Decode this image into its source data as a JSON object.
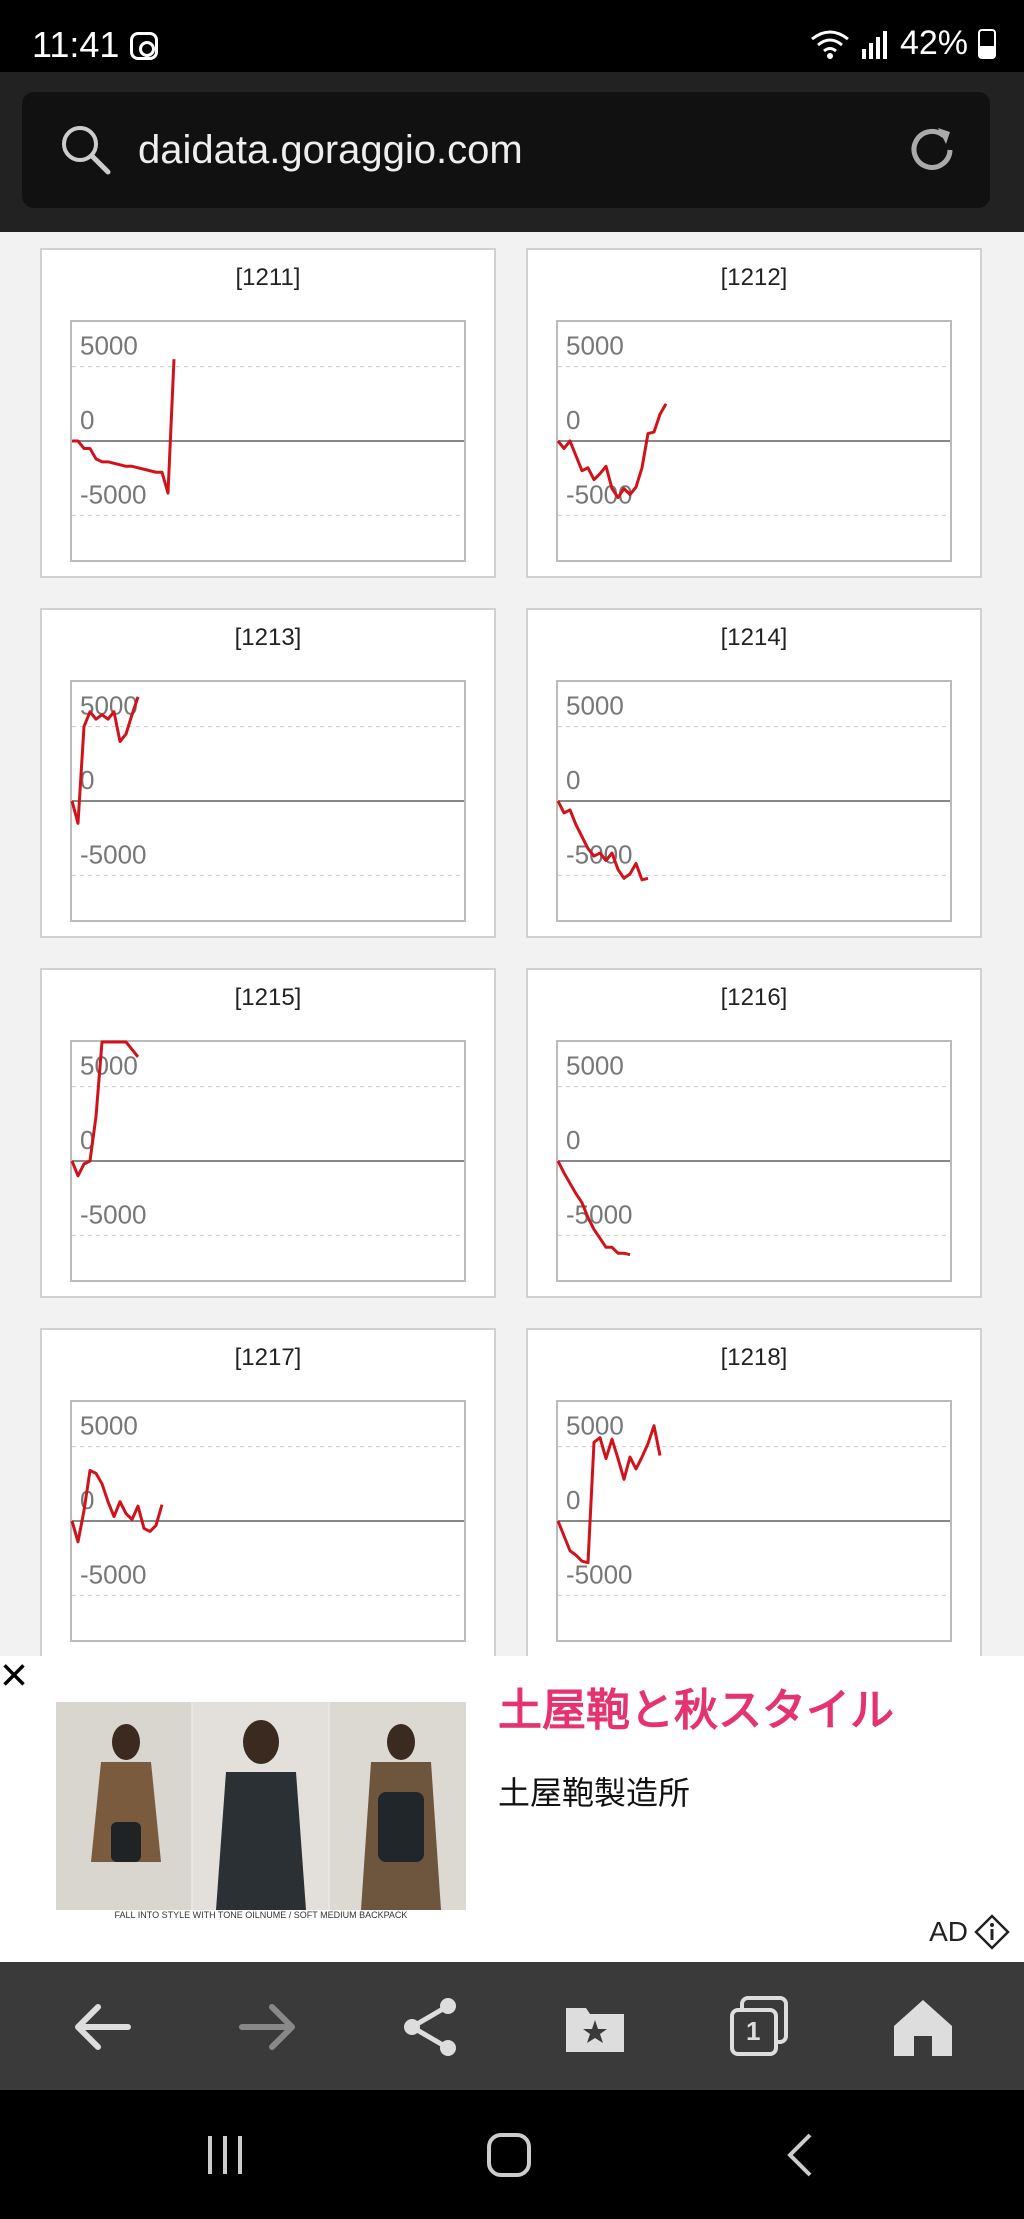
{
  "status": {
    "time": "11:41",
    "battery": "42%",
    "app_icon": "instagram-icon"
  },
  "browser": {
    "url": "daidata.goraggio.com"
  },
  "chart_data": [
    {
      "type": "line",
      "title": "[1211]",
      "ylim": [
        -8000,
        8000
      ],
      "yticks": [
        5000,
        0,
        -5000
      ],
      "series": [
        {
          "values": [
            0,
            0,
            -500,
            -500,
            -1200,
            -1400,
            -1400,
            -1500,
            -1600,
            -1700,
            -1700,
            -1800,
            -1900,
            -2000,
            -2100,
            -2100,
            -3500,
            5500
          ]
        }
      ]
    },
    {
      "type": "line",
      "title": "[1212]",
      "ylim": [
        -8000,
        8000
      ],
      "yticks": [
        5000,
        0,
        -5000
      ],
      "series": [
        {
          "values": [
            0,
            -500,
            0,
            -1000,
            -2000,
            -1800,
            -2600,
            -2200,
            -1700,
            -3200,
            -3800,
            -3200,
            -3600,
            -3100,
            -1800,
            500,
            600,
            1800,
            2500
          ]
        }
      ]
    },
    {
      "type": "line",
      "title": "[1213]",
      "ylim": [
        -8000,
        8000
      ],
      "yticks": [
        5000,
        0,
        -5000
      ],
      "series": [
        {
          "values": [
            0,
            -1500,
            5000,
            6000,
            5500,
            5800,
            5500,
            6000,
            4000,
            4500,
            5800,
            7000
          ]
        }
      ]
    },
    {
      "type": "line",
      "title": "[1214]",
      "ylim": [
        -8000,
        8000
      ],
      "yticks": [
        5000,
        0,
        -5000
      ],
      "series": [
        {
          "values": [
            0,
            -800,
            -600,
            -1600,
            -2400,
            -3200,
            -3700,
            -3500,
            -4000,
            -3500,
            -4600,
            -5200,
            -4900,
            -4200,
            -5300,
            -5200
          ]
        }
      ]
    },
    {
      "type": "line",
      "title": "[1215]",
      "ylim": [
        -8000,
        8000
      ],
      "yticks": [
        5000,
        0,
        -5000
      ],
      "series": [
        {
          "values": [
            0,
            -1000,
            -200,
            0,
            3000,
            8000,
            8000,
            8000,
            8000,
            8000,
            7500,
            7000
          ]
        }
      ]
    },
    {
      "type": "line",
      "title": "[1216]",
      "ylim": [
        -8000,
        8000
      ],
      "yticks": [
        5000,
        0,
        -5000
      ],
      "series": [
        {
          "values": [
            0,
            -800,
            -1500,
            -2200,
            -2800,
            -3800,
            -4600,
            -5200,
            -5800,
            -5800,
            -6200,
            -6200,
            -6300
          ]
        }
      ]
    },
    {
      "type": "line",
      "title": "[1217]",
      "ylim": [
        -8000,
        8000
      ],
      "yticks": [
        5000,
        0,
        -5000
      ],
      "series": [
        {
          "values": [
            0,
            -1400,
            700,
            3400,
            3200,
            2500,
            1300,
            300,
            1300,
            500,
            100,
            1000,
            -500,
            -700,
            -300,
            1100
          ]
        }
      ]
    },
    {
      "type": "line",
      "title": "[1218]",
      "ylim": [
        -8000,
        8000
      ],
      "yticks": [
        5000,
        0,
        -5000
      ],
      "series": [
        {
          "values": [
            0,
            -1000,
            -2000,
            -2300,
            -2700,
            -2800,
            5300,
            5600,
            4200,
            5500,
            4200,
            2800,
            4300,
            3500,
            4300,
            5200,
            6400,
            4400
          ]
        }
      ]
    }
  ],
  "ad": {
    "close": "×",
    "headline": "土屋鞄と秋スタイル",
    "advertiser": "土屋鞄製造所",
    "caption": "FALL INTO STYLE WITH TONE OILNUME / SOFT MEDIUM BACKPACK",
    "label": "AD"
  },
  "nav": {
    "tabs_count": "1"
  }
}
